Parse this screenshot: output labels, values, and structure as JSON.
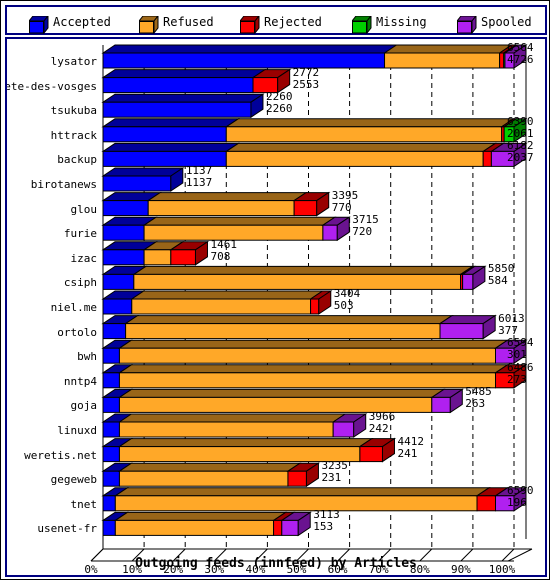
{
  "legend": {
    "items": [
      {
        "label": "Accepted",
        "color": "#0000ff"
      },
      {
        "label": "Refused",
        "color": "#ffa828"
      },
      {
        "label": "Rejected",
        "color": "#ff0000"
      },
      {
        "label": "Missing",
        "color": "#00d000"
      },
      {
        "label": "Spooled",
        "color": "#b020f0"
      }
    ]
  },
  "chart_data": {
    "type": "bar",
    "orientation": "horizontal",
    "stacked": true,
    "percent_stacked": true,
    "title": "",
    "xlabel": "Outgoing feeds (innfeed) by Articles",
    "ylabel": "",
    "xlim": [
      0,
      100
    ],
    "xtick_labels": [
      "0%",
      "10%",
      "20%",
      "30%",
      "40%",
      "50%",
      "60%",
      "70%",
      "80%",
      "90%",
      "100%"
    ],
    "xticks": [
      0,
      10,
      20,
      30,
      40,
      50,
      60,
      70,
      80,
      90,
      100
    ],
    "grid": true,
    "legend_position": "top",
    "series_names": [
      "Accepted",
      "Refused",
      "Rejected",
      "Missing",
      "Spooled"
    ],
    "series_colors": [
      "#0000ff",
      "#ffa828",
      "#ff0000",
      "#00d000",
      "#b020f0"
    ],
    "categories": [
      "lysator",
      "bete-des-vosges",
      "tsukuba",
      "httrack",
      "backup",
      "birotanews",
      "glou",
      "furie",
      "izac",
      "csiph",
      "niel.me",
      "ortolo",
      "bwh",
      "nntp4",
      "goja",
      "linuxd",
      "weretis.net",
      "gegeweb",
      "tnet",
      "usenet-fr"
    ],
    "rows": [
      {
        "category": "lysator",
        "label_top": "6564",
        "label_bottom": "4726",
        "bar_total_pct": 100.0,
        "segments": [
          68.5,
          28.0,
          1.0,
          0.3,
          2.2
        ]
      },
      {
        "category": "bete-des-vosges",
        "label_top": "2772",
        "label_bottom": "2553",
        "bar_total_pct": 42.5,
        "segments": [
          36.5,
          0.0,
          6.0,
          0.0,
          0.0
        ]
      },
      {
        "category": "tsukuba",
        "label_top": "2260",
        "label_bottom": "2260",
        "bar_total_pct": 36.0,
        "segments": [
          36.0,
          0.0,
          0.0,
          0.0,
          0.0
        ]
      },
      {
        "category": "httrack",
        "label_top": "6390",
        "label_bottom": "2061",
        "bar_total_pct": 100.0,
        "segments": [
          30.0,
          67.0,
          0.6,
          2.4,
          0.0
        ]
      },
      {
        "category": "backup",
        "label_top": "6182",
        "label_bottom": "2037",
        "bar_total_pct": 100.0,
        "segments": [
          30.0,
          62.5,
          2.0,
          0.0,
          5.5
        ]
      },
      {
        "category": "birotanews",
        "label_top": "1137",
        "label_bottom": "1137",
        "bar_total_pct": 16.5,
        "segments": [
          16.5,
          0.0,
          0.0,
          0.0,
          0.0
        ]
      },
      {
        "category": "glou",
        "label_top": "3395",
        "label_bottom": "770",
        "bar_total_pct": 52.0,
        "segments": [
          11.0,
          35.5,
          5.5,
          0.0,
          0.0
        ]
      },
      {
        "category": "furie",
        "label_top": "3715",
        "label_bottom": "720",
        "bar_total_pct": 57.0,
        "segments": [
          10.0,
          43.5,
          0.0,
          0.0,
          3.5
        ]
      },
      {
        "category": "izac",
        "label_top": "1461",
        "label_bottom": "708",
        "bar_total_pct": 22.5,
        "segments": [
          10.0,
          6.5,
          6.0,
          0.0,
          0.0
        ]
      },
      {
        "category": "csiph",
        "label_top": "5850",
        "label_bottom": "584",
        "bar_total_pct": 90.0,
        "segments": [
          7.5,
          79.5,
          0.5,
          0.0,
          2.5
        ]
      },
      {
        "category": "niel.me",
        "label_top": "3404",
        "label_bottom": "503",
        "bar_total_pct": 52.5,
        "segments": [
          7.0,
          43.5,
          2.0,
          0.0,
          0.0
        ]
      },
      {
        "category": "ortolo",
        "label_top": "6013",
        "label_bottom": "377",
        "bar_total_pct": 92.5,
        "segments": [
          5.5,
          76.5,
          0.0,
          0.0,
          10.5
        ]
      },
      {
        "category": "bwh",
        "label_top": "6594",
        "label_bottom": "301",
        "bar_total_pct": 100.0,
        "segments": [
          4.0,
          91.5,
          0.0,
          0.0,
          4.5
        ]
      },
      {
        "category": "nntp4",
        "label_top": "6486",
        "label_bottom": "273",
        "bar_total_pct": 100.0,
        "segments": [
          4.0,
          91.5,
          4.5,
          0.0,
          0.0
        ]
      },
      {
        "category": "goja",
        "label_top": "5485",
        "label_bottom": "263",
        "bar_total_pct": 84.5,
        "segments": [
          4.0,
          76.0,
          0.0,
          0.0,
          4.5
        ]
      },
      {
        "category": "linuxd",
        "label_top": "3966",
        "label_bottom": "242",
        "bar_total_pct": 61.0,
        "segments": [
          4.0,
          52.0,
          0.0,
          0.0,
          5.0
        ]
      },
      {
        "category": "weretis.net",
        "label_top": "4412",
        "label_bottom": "241",
        "bar_total_pct": 68.0,
        "segments": [
          4.0,
          58.5,
          5.5,
          0.0,
          0.0
        ]
      },
      {
        "category": "gegeweb",
        "label_top": "3235",
        "label_bottom": "231",
        "bar_total_pct": 49.5,
        "segments": [
          4.0,
          41.0,
          4.5,
          0.0,
          0.0
        ]
      },
      {
        "category": "tnet",
        "label_top": "6590",
        "label_bottom": "196",
        "bar_total_pct": 100.0,
        "segments": [
          3.0,
          88.0,
          4.5,
          0.0,
          4.5
        ]
      },
      {
        "category": "usenet-fr",
        "label_top": "3113",
        "label_bottom": "153",
        "bar_total_pct": 47.5,
        "segments": [
          3.0,
          38.5,
          2.0,
          0.0,
          4.0
        ]
      }
    ]
  }
}
